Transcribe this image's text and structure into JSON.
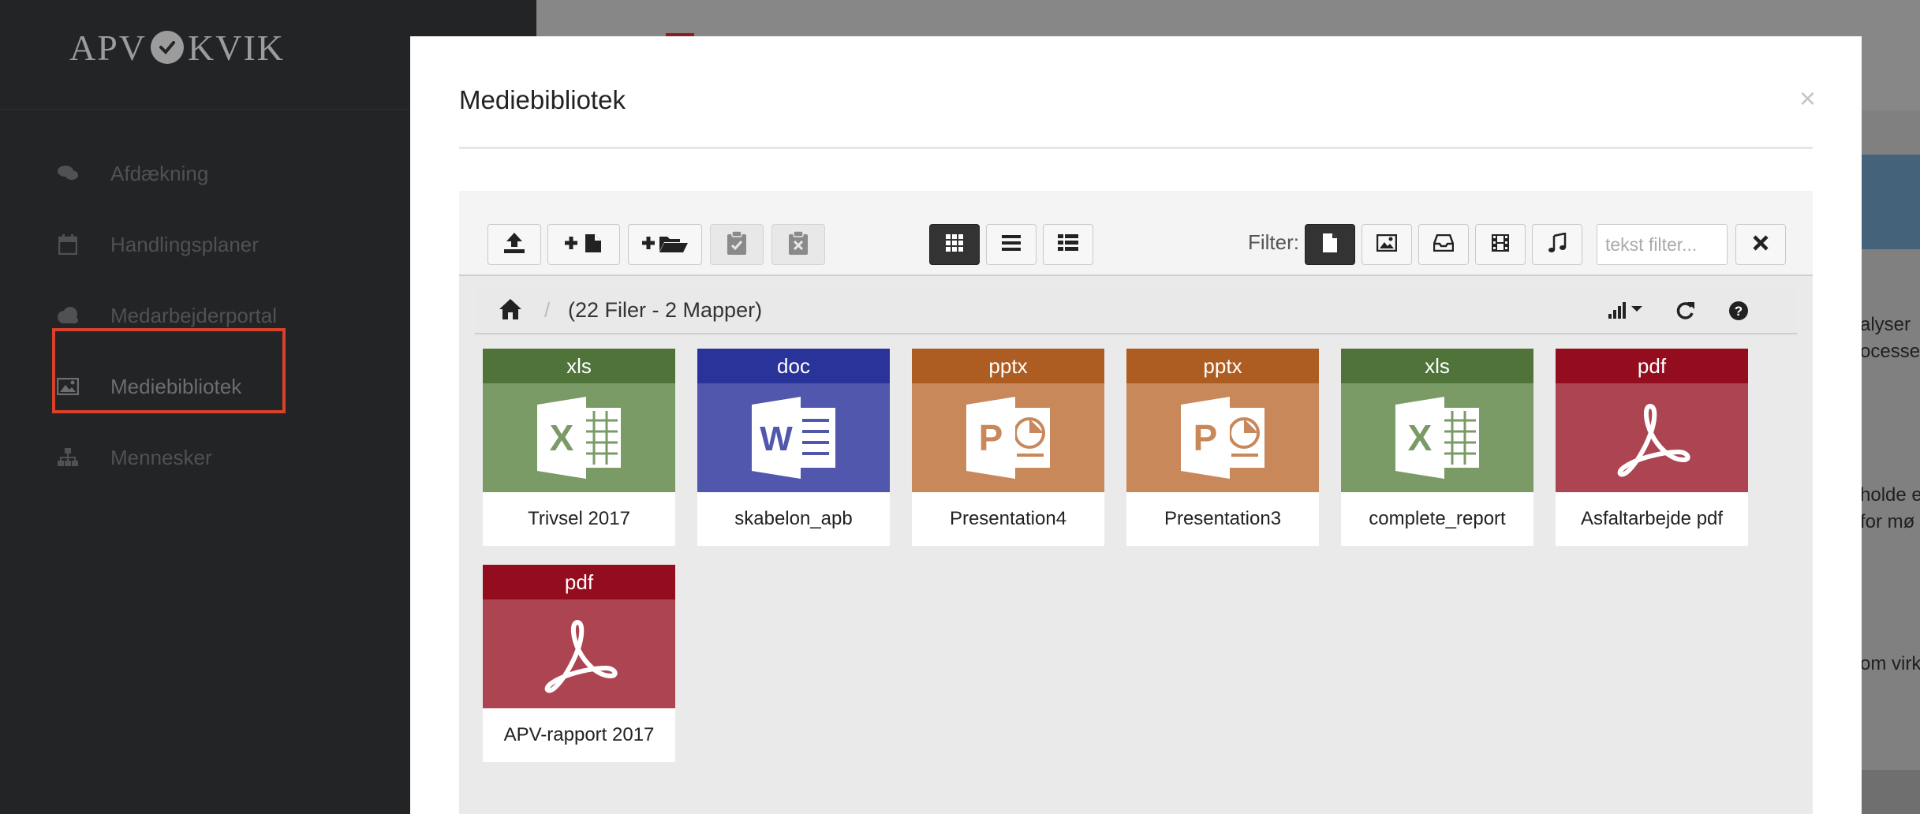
{
  "sidebar": {
    "logo_left": "APV",
    "logo_right": "KVIK",
    "items": [
      {
        "label": "Afdækning",
        "icon": "comments-icon"
      },
      {
        "label": "Handlingsplaner",
        "icon": "calendar-icon"
      },
      {
        "label": "Medarbejderportal",
        "icon": "cloud-icon"
      },
      {
        "label": "Mediebibliotek",
        "icon": "image-icon",
        "active": true
      },
      {
        "label": "Mennesker",
        "icon": "sitemap-icon"
      }
    ]
  },
  "background": {
    "text_lines": [
      "alyser",
      "ocesse",
      "holde e",
      "for mø",
      "om virk"
    ]
  },
  "modal": {
    "title": "Mediebibliotek",
    "close": "×",
    "filter_label": "Filter:",
    "filter_placeholder": "tekst filter...",
    "breadcrumb_count": "(22 Filer - 2 Mapper)",
    "breadcrumb_sep": "/",
    "toolbar_buttons": [
      "upload-icon",
      "new-file-icon",
      "new-folder-icon",
      "paste-icon",
      "clear-clipboard-icon"
    ],
    "view_buttons": [
      "grid-view-icon",
      "list-view-icon",
      "details-view-icon"
    ],
    "filter_buttons": [
      "document-filter-icon",
      "image-filter-icon",
      "archive-filter-icon",
      "video-filter-icon",
      "audio-filter-icon"
    ]
  },
  "colors": {
    "xls": "#4f7339",
    "xls_thumb": "#7a9a66",
    "doc": "#2a3399",
    "doc_thumb": "#5057ad",
    "pptx": "#ad5c22",
    "pptx_thumb": "#c8885a",
    "pdf": "#940d1f",
    "pdf_thumb": "#ad4451",
    "accent_active": "#d9412a"
  },
  "files": [
    {
      "type": "xls",
      "name": "Trivsel 2017"
    },
    {
      "type": "doc",
      "name": "skabelon_apb"
    },
    {
      "type": "pptx",
      "name": "Presentation4"
    },
    {
      "type": "pptx",
      "name": "Presentation3"
    },
    {
      "type": "xls",
      "name": "complete_report"
    },
    {
      "type": "pdf",
      "name": "Asfaltarbejde pdf"
    },
    {
      "type": "pdf",
      "name": "APV-rapport 2017"
    }
  ]
}
